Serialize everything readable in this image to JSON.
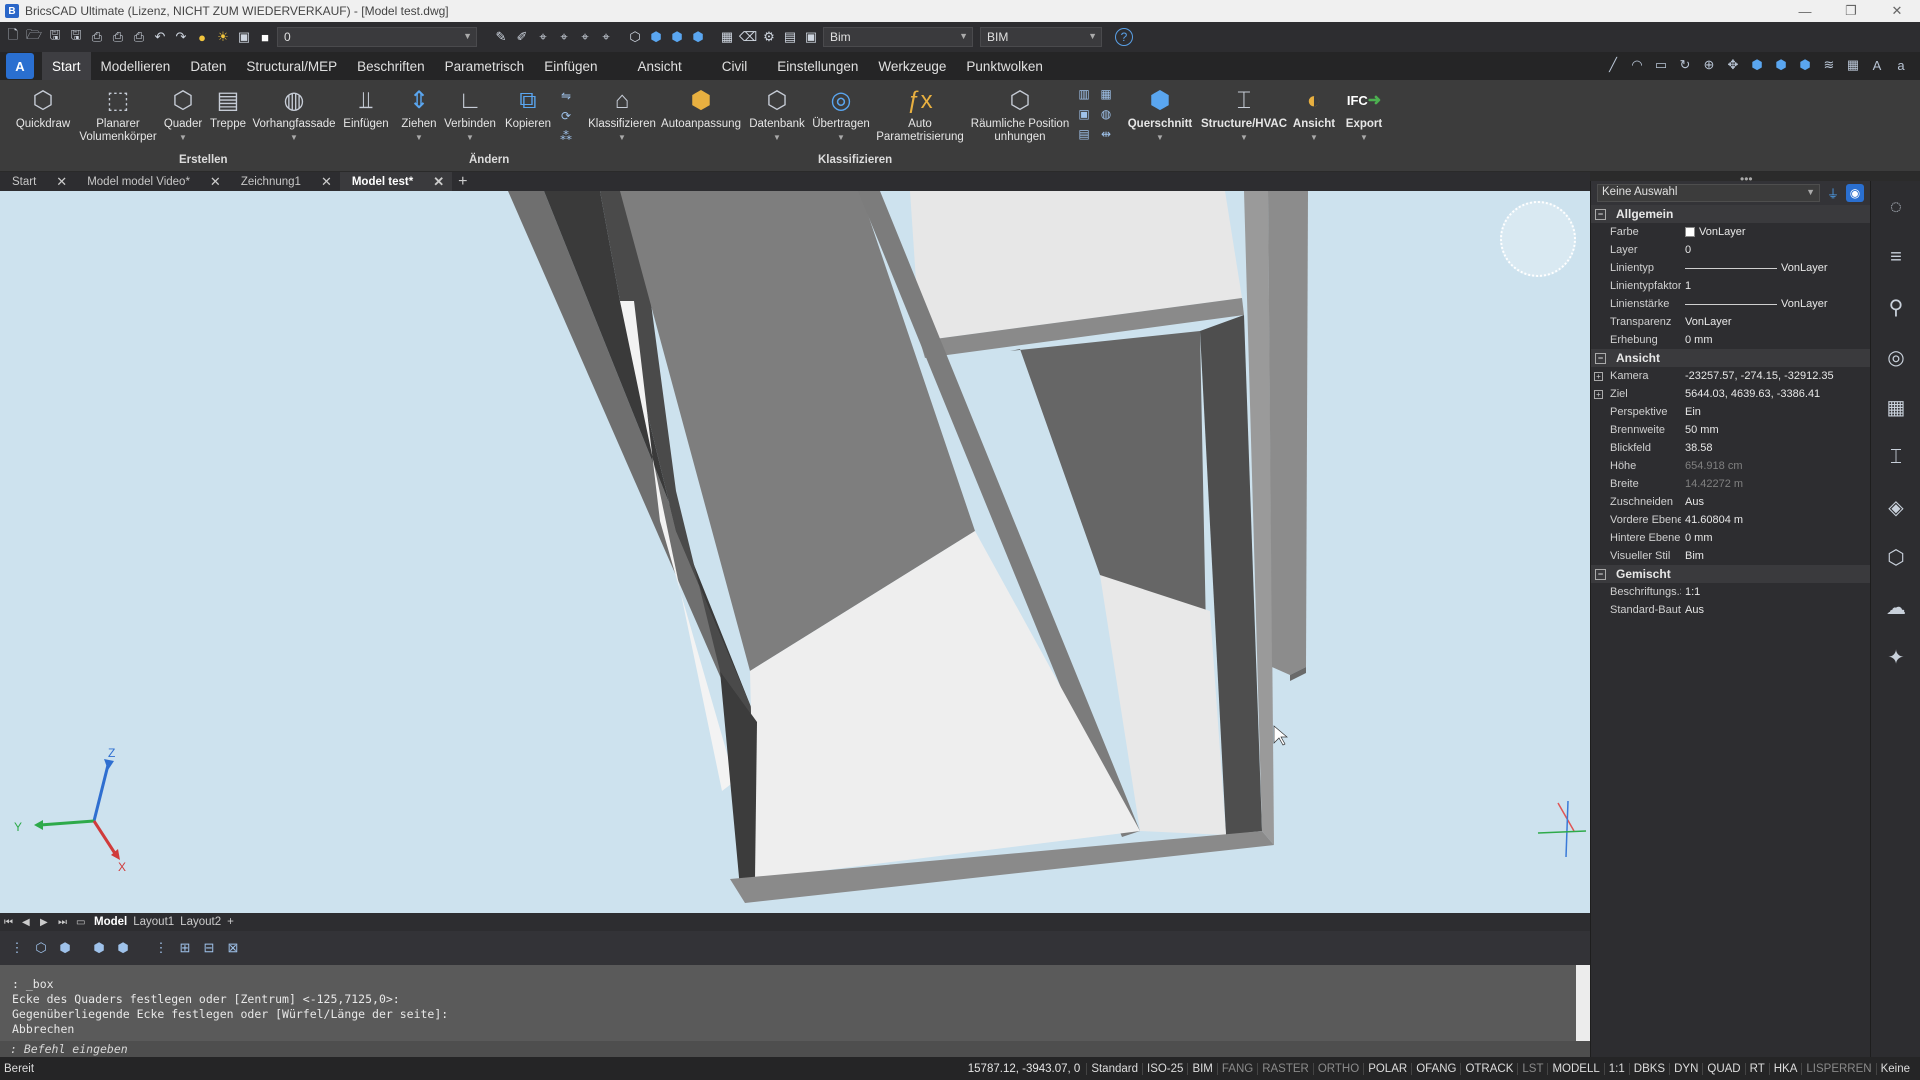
{
  "window": {
    "title": "BricsCAD Ultimate (Lizenz, NICHT ZUM WIEDERVERKAUF) - [Model test.dwg]",
    "controls": [
      "—",
      "❐",
      "✕"
    ]
  },
  "quickaccess": {
    "layer_value": "0",
    "workspace_value": "Bim",
    "profile_value": "BIM",
    "help_label": "?"
  },
  "menu": {
    "app_button": "A",
    "items": [
      "Start",
      "Modellieren",
      "Daten",
      "Structural/MEP",
      "Beschriften",
      "Parametrisch",
      "Einfügen",
      "Ansicht",
      "Civil",
      "Einstellungen",
      "Werkzeuge",
      "Punktwolken"
    ]
  },
  "ribbon": {
    "tools": [
      {
        "label": "Quickdraw",
        "label2": ""
      },
      {
        "label": "Planarer",
        "label2": "Volumenkörper"
      },
      {
        "label": "Quader",
        "label2": ""
      },
      {
        "label": "Treppe",
        "label2": ""
      },
      {
        "label": "Vorhangfassade",
        "label2": ""
      },
      {
        "label": "Einfügen",
        "label2": ""
      },
      {
        "label": "Ziehen",
        "label2": ""
      },
      {
        "label": "Verbinden",
        "label2": ""
      },
      {
        "label": "Kopieren",
        "label2": ""
      },
      {
        "label": "Klassifizieren",
        "label2": ""
      },
      {
        "label": "Autoanpassung",
        "label2": ""
      },
      {
        "label": "Datenbank",
        "label2": ""
      },
      {
        "label": "Übertragen",
        "label2": ""
      },
      {
        "label": "Auto",
        "label2": "Parametrisierung"
      },
      {
        "label": "Räumliche Position",
        "label2": "unhungen"
      },
      {
        "label": "Querschnitt",
        "label2": ""
      },
      {
        "label": "Structure/HVAC",
        "label2": ""
      },
      {
        "label": "Ansicht",
        "label2": ""
      },
      {
        "label": "Export",
        "label2": ""
      }
    ],
    "ifc_label": "IFC",
    "groups": [
      "Erstellen",
      "Ändern",
      "Klassifizieren"
    ]
  },
  "doctabs": [
    {
      "label": "Start"
    },
    {
      "label": "Model model Video*"
    },
    {
      "label": "Zeichnung1"
    },
    {
      "label": "Model test*"
    }
  ],
  "layouttabs": [
    "Model",
    "Layout1",
    "Layout2"
  ],
  "command": {
    "history": [
      ": _box",
      "Ecke des Quaders festlegen oder [Zentrum] <-125,7125,0>:",
      "Gegenüberliegende Ecke festlegen oder [Würfel/Länge der seite]:",
      "Abbrechen"
    ],
    "prompt": ": Befehl eingeben"
  },
  "properties": {
    "selection": "Keine Auswahl",
    "sections": [
      {
        "name": "Allgemein",
        "rows": [
          {
            "key": "Farbe",
            "value": "VonLayer",
            "kind": "swatch"
          },
          {
            "key": "Layer",
            "value": "0"
          },
          {
            "key": "Linientyp",
            "value": "VonLayer",
            "kind": "line"
          },
          {
            "key": "Linientypfaktor",
            "value": "1"
          },
          {
            "key": "Linienstärke",
            "value": "VonLayer",
            "kind": "line"
          },
          {
            "key": "Transparenz",
            "value": "VonLayer"
          },
          {
            "key": "Erhebung",
            "value": "0 mm"
          }
        ]
      },
      {
        "name": "Ansicht",
        "rows": [
          {
            "key": "Kamera",
            "value": "-23257.57, -274.15, -32912.35",
            "expand": true
          },
          {
            "key": "Ziel",
            "value": "5644.03, 4639.63, -3386.41",
            "expand": true
          },
          {
            "key": "Perspektive",
            "value": "Ein"
          },
          {
            "key": "Brennweite",
            "value": "50 mm"
          },
          {
            "key": "Blickfeld",
            "value": "38.58"
          },
          {
            "key": "Höhe",
            "value": "654.918 cm",
            "dim": true
          },
          {
            "key": "Breite",
            "value": "14.42272 m",
            "dim": true
          },
          {
            "key": "Zuschneiden",
            "value": "Aus"
          },
          {
            "key": "Vordere Ebene",
            "value": "41.60804 m"
          },
          {
            "key": "Hintere Ebene",
            "value": "0 mm"
          },
          {
            "key": "Visueller Stil",
            "value": "Bim"
          }
        ]
      },
      {
        "name": "Gemischt",
        "rows": [
          {
            "key": "Beschriftungs.Sk",
            "value": "1:1"
          },
          {
            "key": "Standard-Bauteil",
            "value": "Aus"
          }
        ]
      }
    ]
  },
  "status": {
    "ready": "Bereit",
    "coords": "15787.12, -3943.07, 0",
    "items": [
      {
        "label": "Standard",
        "on": true
      },
      {
        "label": "ISO-25",
        "on": true
      },
      {
        "label": "BIM",
        "on": true
      },
      {
        "label": "FANG",
        "on": false
      },
      {
        "label": "RASTER",
        "on": false
      },
      {
        "label": "ORTHO",
        "on": false
      },
      {
        "label": "POLAR",
        "on": true
      },
      {
        "label": "OFANG",
        "on": true
      },
      {
        "label": "OTRACK",
        "on": true
      },
      {
        "label": "LST",
        "on": false
      },
      {
        "label": "MODELL",
        "on": true
      },
      {
        "label": "1:1",
        "on": true
      },
      {
        "label": "DBKS",
        "on": true
      },
      {
        "label": "DYN",
        "on": true
      },
      {
        "label": "QUAD",
        "on": true
      },
      {
        "label": "RT",
        "on": true
      },
      {
        "label": "HKA",
        "on": true
      },
      {
        "label": "LISPERREN",
        "on": false
      },
      {
        "label": "Keine",
        "on": true
      }
    ]
  },
  "axes": {
    "x": "X",
    "y": "Y",
    "z": "Z"
  }
}
